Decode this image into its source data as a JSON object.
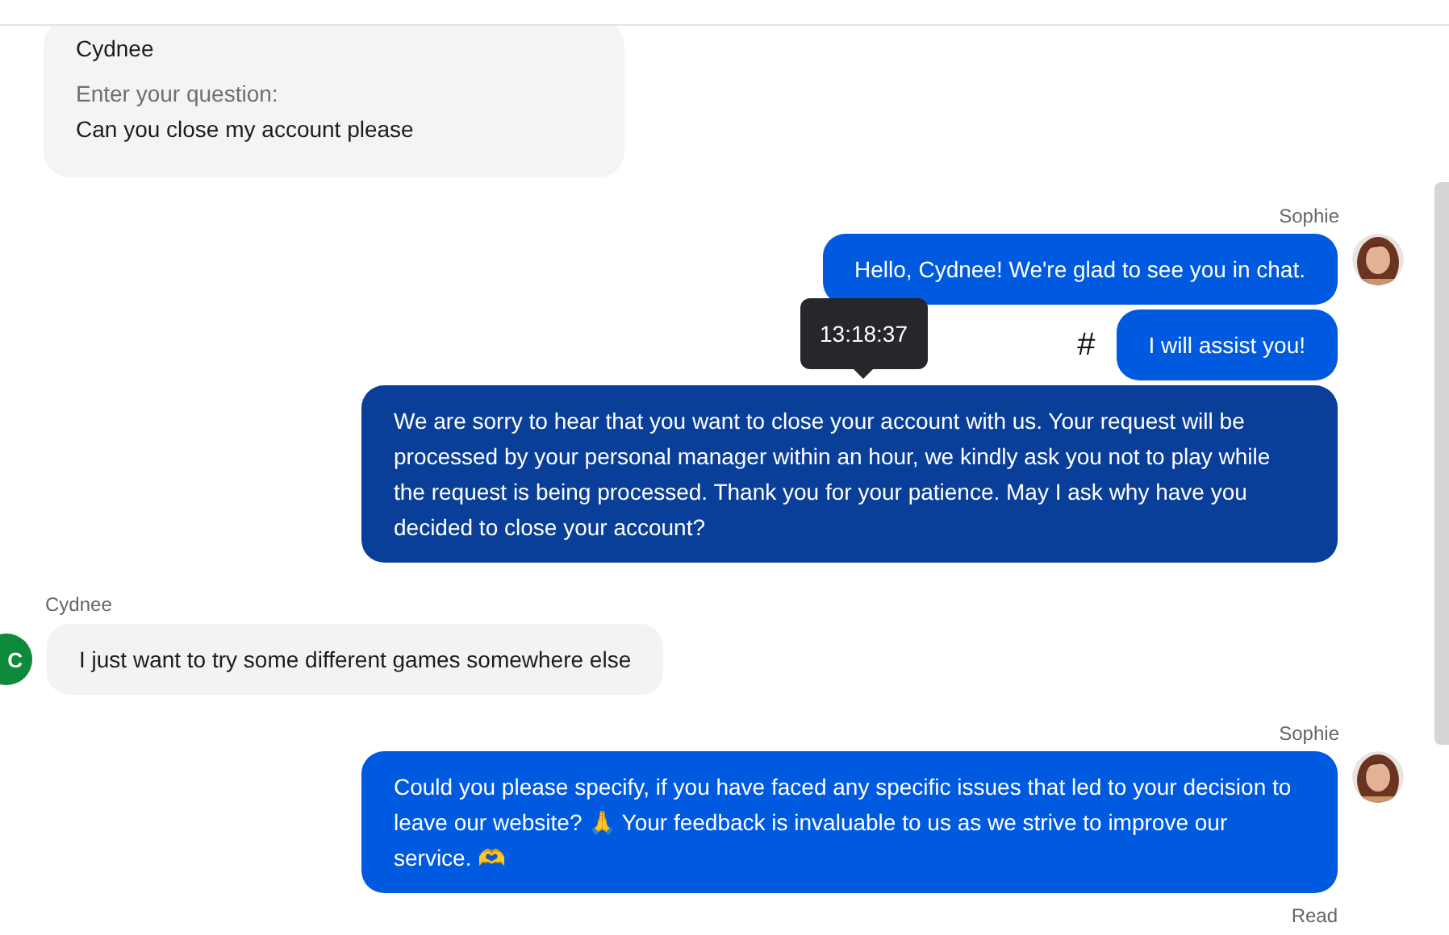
{
  "messages": [
    {
      "kind": "form",
      "sender": "Cydnee",
      "fields": [
        {
          "label": "Enter your question:",
          "value": "Can you close my account please"
        }
      ]
    },
    {
      "kind": "agent",
      "sender": "Sophie",
      "bubbles": [
        {
          "text": "Hello, Cydnee! We're glad to see you in chat.",
          "hovered": false
        },
        {
          "text": "I will assist you!",
          "hovered": false,
          "mark": "#"
        },
        {
          "text": "We are sorry to hear that you want to close your account with us. Your request will be processed by your personal manager within an hour, we kindly ask you not to play while the request is being processed. Thank you for your patience. May I ask why have you decided to close your account?",
          "hovered": true,
          "tooltip": "13:18:37"
        }
      ]
    },
    {
      "kind": "user",
      "sender": "Cydnee",
      "initial": "C",
      "bubbles": [
        {
          "text": "I just want to try some different games somewhere else",
          "hovered": false
        }
      ]
    },
    {
      "kind": "agent",
      "sender": "Sophie",
      "status": "Read",
      "bubbles": [
        {
          "text": "Could you please specify, if you have faced any specific issues that led to your decision to leave our website? 🙏 Your feedback is invaluable to us as we strive to improve our service. 🫶",
          "hovered": false
        }
      ]
    }
  ]
}
